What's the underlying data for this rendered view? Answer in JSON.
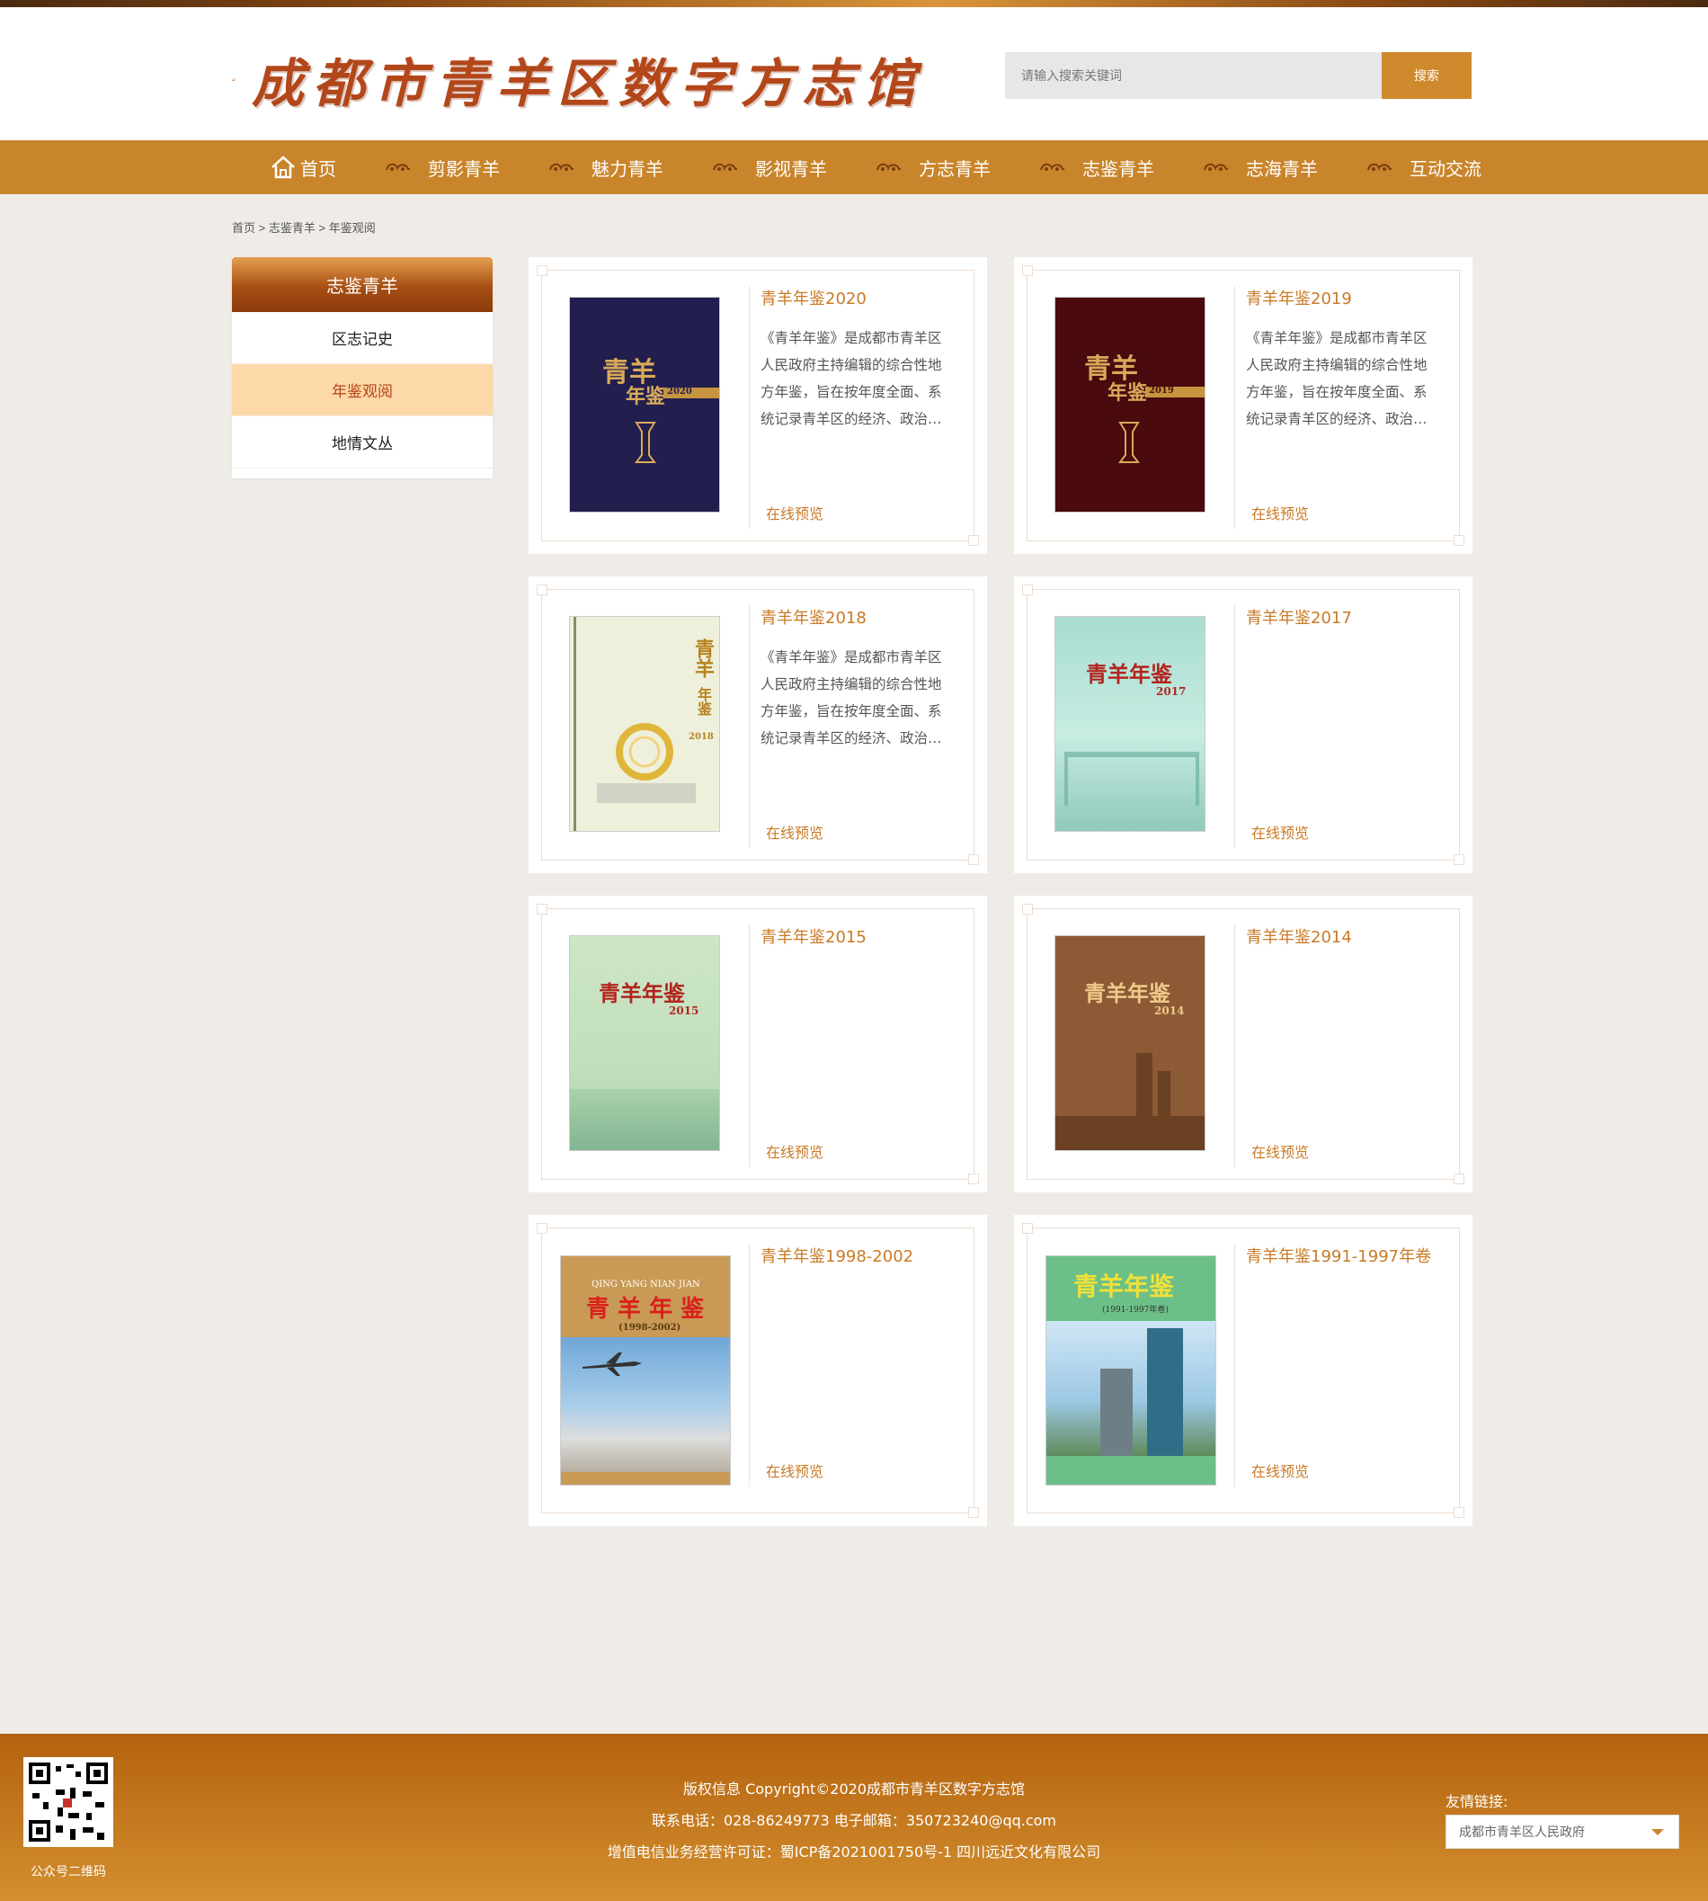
{
  "site": {
    "logo_text": "成都市青羊区数字方志馆"
  },
  "search": {
    "placeholder": "请输入搜索关键词",
    "button_label": "搜索"
  },
  "nav": {
    "items": [
      {
        "label": "首页",
        "icon": "home-icon"
      },
      {
        "label": "剪影青羊",
        "icon": "cloud-ornament-icon"
      },
      {
        "label": "魅力青羊",
        "icon": "cloud-ornament-icon"
      },
      {
        "label": "影视青羊",
        "icon": "cloud-ornament-icon"
      },
      {
        "label": "方志青羊",
        "icon": "cloud-ornament-icon"
      },
      {
        "label": "志鉴青羊",
        "icon": "cloud-ornament-icon"
      },
      {
        "label": "志海青羊",
        "icon": "cloud-ornament-icon"
      },
      {
        "label": "互动交流",
        "icon": "cloud-ornament-icon"
      }
    ]
  },
  "breadcrumb": {
    "home": "首页",
    "sep1": " > ",
    "section": "志鉴青羊",
    "sep2": " > ",
    "current": "年鉴观阅"
  },
  "sidebar": {
    "title": "志鉴青羊",
    "items": [
      {
        "label": "区志记史",
        "active": false
      },
      {
        "label": "年鉴观阅",
        "active": true
      },
      {
        "label": "地情文丛",
        "active": false
      }
    ]
  },
  "cards": [
    {
      "title": "青羊年鉴2020",
      "desc": "《青羊年鉴》是成都市青羊区人民政府主持编辑的综合性地方年鉴，旨在按年度全面、系统记录青羊区的经济、政治、文化、社会等各方面情况。",
      "preview": "在线预览",
      "cover": {
        "style": "navy",
        "line1": "青羊",
        "line2": "年鉴",
        "year": "2020"
      }
    },
    {
      "title": "青羊年鉴2019",
      "desc": "《青羊年鉴》是成都市青羊区人民政府主持编辑的综合性地方年鉴，旨在按年度全面、系统记录青羊区的经济、政治、文化、社会等各方面情况。",
      "preview": "在线预览",
      "cover": {
        "style": "maroon",
        "line1": "青羊",
        "line2": "年鉴",
        "year": "2019"
      }
    },
    {
      "title": "青羊年鉴2018",
      "desc": "《青羊年鉴》是成都市青羊区人民政府主持编辑的综合性地方年鉴，旨在按年度全面、系统记录青羊区的经济、政治、文化、社会等各方面情况。",
      "preview": "在线预览",
      "cover": {
        "style": "cream",
        "line1": "青羊",
        "line2": "年鉴",
        "year": "2018"
      }
    },
    {
      "title": "青羊年鉴2017",
      "desc": "",
      "preview": "在线预览",
      "cover": {
        "style": "mint",
        "line1": "青羊年鉴",
        "line2": "",
        "year": "2017"
      }
    },
    {
      "title": "青羊年鉴2015",
      "desc": "",
      "preview": "在线预览",
      "cover": {
        "style": "sage",
        "line1": "青羊年鉴",
        "line2": "",
        "year": "2015"
      }
    },
    {
      "title": "青羊年鉴2014",
      "desc": "",
      "preview": "在线预览",
      "cover": {
        "style": "brown",
        "line1": "青羊年鉴",
        "line2": "",
        "year": "2014"
      }
    },
    {
      "title": "青羊年鉴1998-2002",
      "desc": "",
      "preview": "在线预览",
      "cover": {
        "style": "tan-photo",
        "line1": "青 羊 年 鉴",
        "line2": "QING YANG NIAN JIAN",
        "year": "(1998-2002)"
      }
    },
    {
      "title": "青羊年鉴1991-1997年卷",
      "desc": "",
      "preview": "在线预览",
      "cover": {
        "style": "green-photo",
        "line1": "青羊年鉴",
        "line2": "",
        "year": "(1991-1997年卷)"
      }
    }
  ],
  "footer": {
    "qr_label": "公众号二维码",
    "copyright": "版权信息 Copyright©2020成都市青羊区数字方志馆",
    "contact": "联系电话：028-86249773 电子邮箱：350723240@qq.com",
    "license": "增值电信业务经营许可证：蜀ICP备2021001750号-1 四川远近文化有限公司",
    "friend_label": "友情链接:",
    "friend_selected": "成都市青羊区人民政府"
  },
  "colors": {
    "accent": "#c9852b",
    "link": "#c97a25",
    "active_bg": "#fdd8a8",
    "page_bg": "#efece8"
  }
}
